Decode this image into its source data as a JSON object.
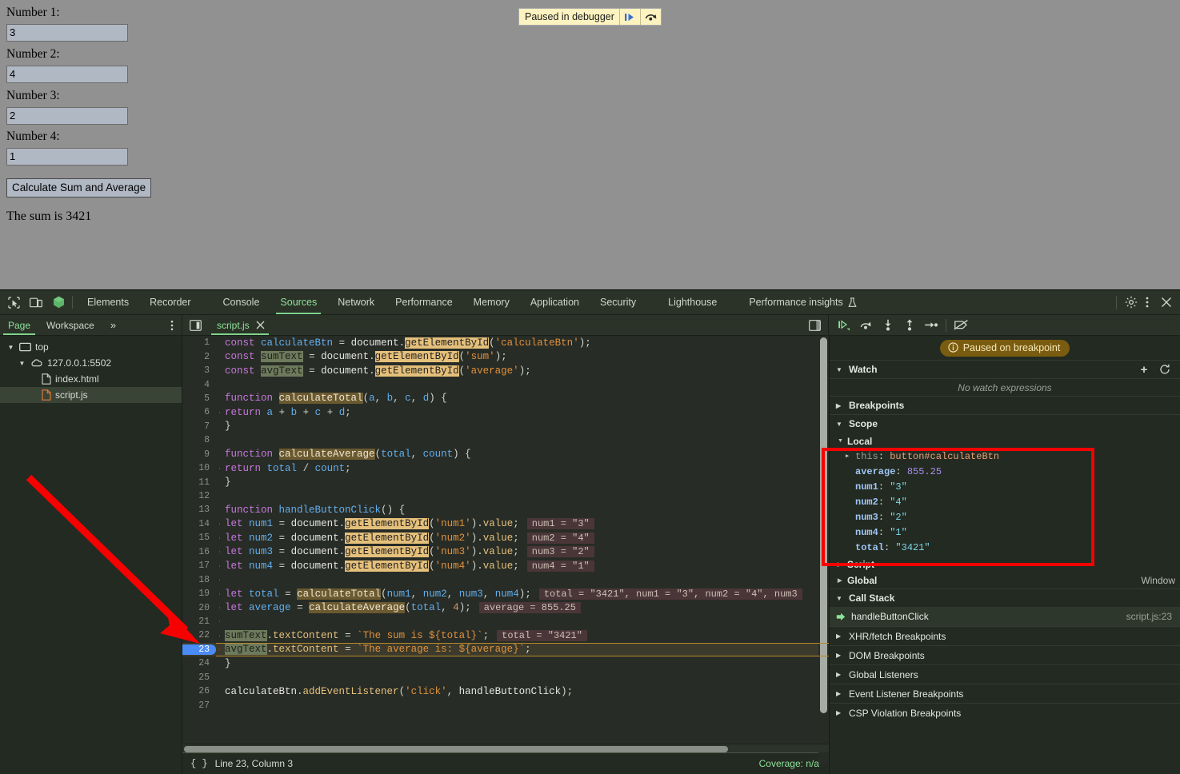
{
  "page": {
    "fields": [
      {
        "label": "Number 1:",
        "value": "3",
        "name": "num1"
      },
      {
        "label": "Number 2:",
        "value": "4",
        "name": "num2"
      },
      {
        "label": "Number 3:",
        "value": "2",
        "name": "num3"
      },
      {
        "label": "Number 4:",
        "value": "1",
        "name": "num4"
      }
    ],
    "button_label": "Calculate Sum and Average",
    "sum_text": "The sum is 3421",
    "background_color": "#919191"
  },
  "paused_bar": {
    "text": "Paused in debugger",
    "resume_icon": "resume-icon",
    "step_over_icon": "step-over-icon",
    "background_color": "#fcf3c0"
  },
  "devtools": {
    "accent_color": "#7fd38c",
    "background_color": "#232a21",
    "main_tabs": [
      {
        "label": "Elements",
        "selected": false
      },
      {
        "label": "Recorder",
        "selected": false
      },
      {
        "label": "Console",
        "selected": false
      },
      {
        "label": "Sources",
        "selected": true
      },
      {
        "label": "Network",
        "selected": false
      },
      {
        "label": "Performance",
        "selected": false
      },
      {
        "label": "Memory",
        "selected": false
      },
      {
        "label": "Application",
        "selected": false
      },
      {
        "label": "Security",
        "selected": false
      },
      {
        "label": "Lighthouse",
        "selected": false
      },
      {
        "label": "Performance insights",
        "selected": false
      }
    ],
    "left_icons": [
      "inspect-element-icon",
      "device-toolbar-icon",
      "lighthouse-cube-icon"
    ],
    "right_icons": [
      "gear-icon",
      "kebab-menu-icon",
      "close-icon"
    ],
    "nav_tabs": [
      {
        "label": "Page",
        "selected": true
      },
      {
        "label": "Workspace",
        "selected": false
      },
      {
        "label": "»",
        "selected": false
      }
    ],
    "nav_more_icon": "kebab-menu-icon",
    "editor_tab": {
      "label": "script.js",
      "close_icon": "close-icon"
    },
    "panel_toggle_icon": "show-navigator-icon",
    "editor_right_icon": "show-debugger-icon",
    "debug_buttons": [
      "resume-script-execution-icon",
      "step-over-next-function-call-icon",
      "step-into-next-function-call-icon",
      "step-out-of-current-function-icon",
      "step-icon",
      "deactivate-breakpoints-icon"
    ],
    "file_tree": [
      {
        "label": "top",
        "depth": 0,
        "icon": "frame-icon",
        "expanded": true,
        "selected": false
      },
      {
        "label": "127.0.0.1:5502",
        "depth": 1,
        "icon": "cloud-icon",
        "expanded": true,
        "selected": false
      },
      {
        "label": "index.html",
        "depth": 2,
        "icon": "document-icon",
        "expanded": null,
        "selected": false
      },
      {
        "label": "script.js",
        "depth": 2,
        "icon": "script-icon",
        "expanded": null,
        "selected": true
      }
    ],
    "status_bar": {
      "format_icon": "pretty-print-icon",
      "cursor_position": "Line 23, Column 3",
      "coverage": "Coverage: n/a"
    }
  },
  "code": {
    "lines": [
      {
        "n": 1,
        "indent": false,
        "text": "const calculateBtn = document.getElementById('calculateBtn');"
      },
      {
        "n": 2,
        "indent": false,
        "text": "const sumText = document.getElementById('sum');"
      },
      {
        "n": 3,
        "indent": false,
        "text": "const avgText = document.getElementById('average');"
      },
      {
        "n": 4,
        "indent": false,
        "text": ""
      },
      {
        "n": 5,
        "indent": false,
        "text": "function calculateTotal(a, b, c, d) {"
      },
      {
        "n": 6,
        "indent": true,
        "text": "  return a + b + c + d;"
      },
      {
        "n": 7,
        "indent": false,
        "text": "}"
      },
      {
        "n": 8,
        "indent": false,
        "text": ""
      },
      {
        "n": 9,
        "indent": false,
        "text": "function calculateAverage(total, count) {"
      },
      {
        "n": 10,
        "indent": true,
        "text": "  return total / count;"
      },
      {
        "n": 11,
        "indent": false,
        "text": "}"
      },
      {
        "n": 12,
        "indent": false,
        "text": ""
      },
      {
        "n": 13,
        "indent": false,
        "text": "function handleButtonClick() {"
      },
      {
        "n": 14,
        "indent": true,
        "text": "  let num1 = document.getElementById('num1').value;",
        "inline": "num1 = \"3\""
      },
      {
        "n": 15,
        "indent": true,
        "text": "  let num2 = document.getElementById('num2').value;",
        "inline": "num2 = \"4\""
      },
      {
        "n": 16,
        "indent": true,
        "text": "  let num3 = document.getElementById('num3').value;",
        "inline": "num3 = \"2\""
      },
      {
        "n": 17,
        "indent": true,
        "text": "  let num4 = document.getElementById('num4').value;",
        "inline": "num4 = \"1\""
      },
      {
        "n": 18,
        "indent": true,
        "text": ""
      },
      {
        "n": 19,
        "indent": true,
        "text": "  let total = calculateTotal(num1, num2, num3, num4);",
        "inline": "total = \"3421\", num1 = \"3\", num2 = \"4\", num3"
      },
      {
        "n": 20,
        "indent": true,
        "text": "  let average = calculateAverage(total, 4);",
        "inline": "average = 855.25"
      },
      {
        "n": 21,
        "indent": true,
        "text": ""
      },
      {
        "n": 22,
        "indent": true,
        "text": "  sumText.textContent = `The sum is ${total}`;",
        "inline": "total = \"3421\""
      },
      {
        "n": 23,
        "indent": true,
        "text": "  avgText.textContent = `The average is: ${average}`;",
        "executing": true
      },
      {
        "n": 24,
        "indent": false,
        "text": "}"
      },
      {
        "n": 25,
        "indent": false,
        "text": ""
      },
      {
        "n": 26,
        "indent": false,
        "text": "calculateBtn.addEventListener('click', handleButtonClick);"
      },
      {
        "n": 27,
        "indent": false,
        "text": ""
      }
    ]
  },
  "debugger_sidebar": {
    "paused_pill": {
      "label": "Paused on breakpoint",
      "icon": "info-icon",
      "background_color": "#7a5c10"
    },
    "watch": {
      "title": "Watch",
      "add_icon": "plus-icon",
      "refresh_icon": "refresh-icon",
      "empty_text": "No watch expressions",
      "expanded": true
    },
    "breakpoints": {
      "title": "Breakpoints",
      "expanded": false
    },
    "scope": {
      "title": "Scope",
      "expanded": true,
      "local": {
        "title": "Local",
        "expanded": true,
        "entries": [
          {
            "name": "this",
            "value": "button#calculateBtn",
            "kind": "object",
            "expandable": true,
            "dim_name": true
          },
          {
            "name": "average",
            "value": "855.25",
            "kind": "number",
            "expandable": false
          },
          {
            "name": "num1",
            "value": "\"3\"",
            "kind": "string",
            "expandable": false
          },
          {
            "name": "num2",
            "value": "\"4\"",
            "kind": "string",
            "expandable": false
          },
          {
            "name": "num3",
            "value": "\"2\"",
            "kind": "string",
            "expandable": false
          },
          {
            "name": "num4",
            "value": "\"1\"",
            "kind": "string",
            "expandable": false
          },
          {
            "name": "total",
            "value": "\"3421\"",
            "kind": "string",
            "expandable": false
          }
        ]
      },
      "script": {
        "title": "Script",
        "expanded": false,
        "value": ""
      },
      "global": {
        "title": "Global",
        "expanded": false,
        "value": "Window"
      }
    },
    "call_stack": {
      "title": "Call Stack",
      "expanded": true,
      "frames": [
        {
          "name": "handleButtonClick",
          "location": "script.js:23",
          "active": true
        }
      ]
    },
    "other_sections": [
      {
        "title": "XHR/fetch Breakpoints",
        "expanded": false
      },
      {
        "title": "DOM Breakpoints",
        "expanded": false
      },
      {
        "title": "Global Listeners",
        "expanded": false
      },
      {
        "title": "Event Listener Breakpoints",
        "expanded": false
      },
      {
        "title": "CSP Violation Breakpoints",
        "expanded": false
      }
    ]
  },
  "annotations": {
    "red_box": {
      "color": "#f70000",
      "target": "local-scope-variables"
    },
    "red_arrow": {
      "color": "#f70000",
      "target": "line-23-execution-marker"
    }
  }
}
